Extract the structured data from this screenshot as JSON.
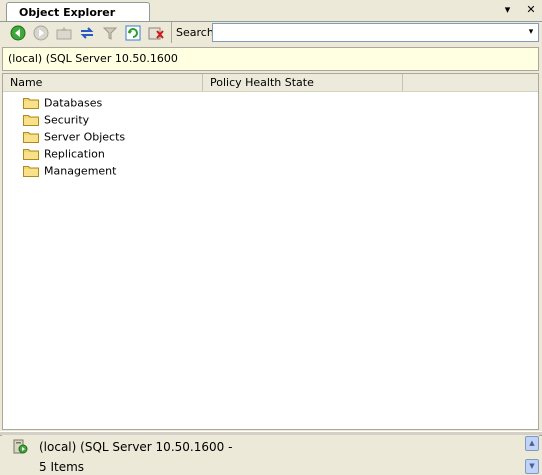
{
  "tab": {
    "title": "Object Explorer Details",
    "pin_glyph": "▾",
    "close_glyph": "✕"
  },
  "toolbar": {
    "search_label": "Search",
    "search_value": "",
    "dropdown_glyph": "▾"
  },
  "pathbar": {
    "text": "(local) (SQL Server 10.50.1600"
  },
  "list": {
    "columns": [
      "Name",
      "Policy Health State"
    ],
    "items": [
      "Databases",
      "Security",
      "Server Objects",
      "Replication",
      "Management"
    ]
  },
  "info": {
    "line1": "(local) (SQL Server 10.50.1600 -",
    "line2": "5 Items"
  },
  "colors": {
    "background": "#ece9d8",
    "folder": "#f5d66a",
    "path_bar": "#ffffe1"
  }
}
